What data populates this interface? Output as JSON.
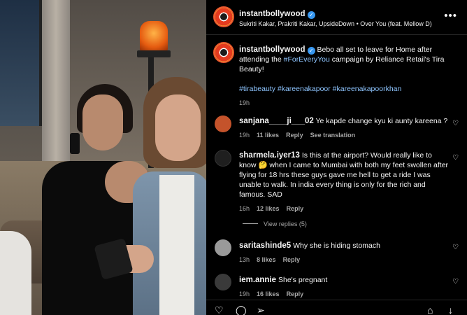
{
  "post": {
    "username": "instantbollywood",
    "audio": "Sukriti Kakar, Prakriti Kakar, UpsideDown • Over You (feat. Mellow D)",
    "caption": {
      "text": "Bebo all set to leave for Home after attending the ",
      "tag1": "#ForEveryYou",
      "text2": " campaign by Reliance Retail's Tira Beauty!",
      "hashtags": "#tirabeauty #kareenakapoor #kareenakapoorkhan",
      "time": "19h"
    }
  },
  "comments": [
    {
      "username": "sanjana____ji___02",
      "text": "Ye kapde change kyu ki aunty kareena ?",
      "time": "19h",
      "likes": "11 likes",
      "reply": "Reply",
      "extra": "See translation",
      "avatar_color": "#c4532b"
    },
    {
      "username": "sharmela.iyer13",
      "text_before": "Is this at the airport? Would really like to know",
      "emoji": "🤔",
      "text": " when I came to Mumbai with both my feet swollen after flying for 18 hrs these guys gave me hell to get a ride I was unable to walk. In india every thing is only for the rich and famous. SAD",
      "time": "16h",
      "likes": "12 likes",
      "reply": "Reply",
      "view_replies": "View replies (5)",
      "avatar_color": "#1f1f1f"
    },
    {
      "username": "saritashinde5",
      "text": "Why she is hiding stomach",
      "time": "13h",
      "likes": "8 likes",
      "reply": "Reply",
      "avatar_color": "#9a9a9a"
    },
    {
      "username": "iem.annie",
      "text": "She's pregnant",
      "time": "19h",
      "likes": "16 likes",
      "reply": "Reply",
      "avatar_color": "#3a3a3a"
    }
  ],
  "icons": {
    "verified": "✓",
    "more": "•••",
    "heart": "♡",
    "comment": "◯",
    "share": "➢",
    "save": "⌂",
    "download": "↓"
  }
}
